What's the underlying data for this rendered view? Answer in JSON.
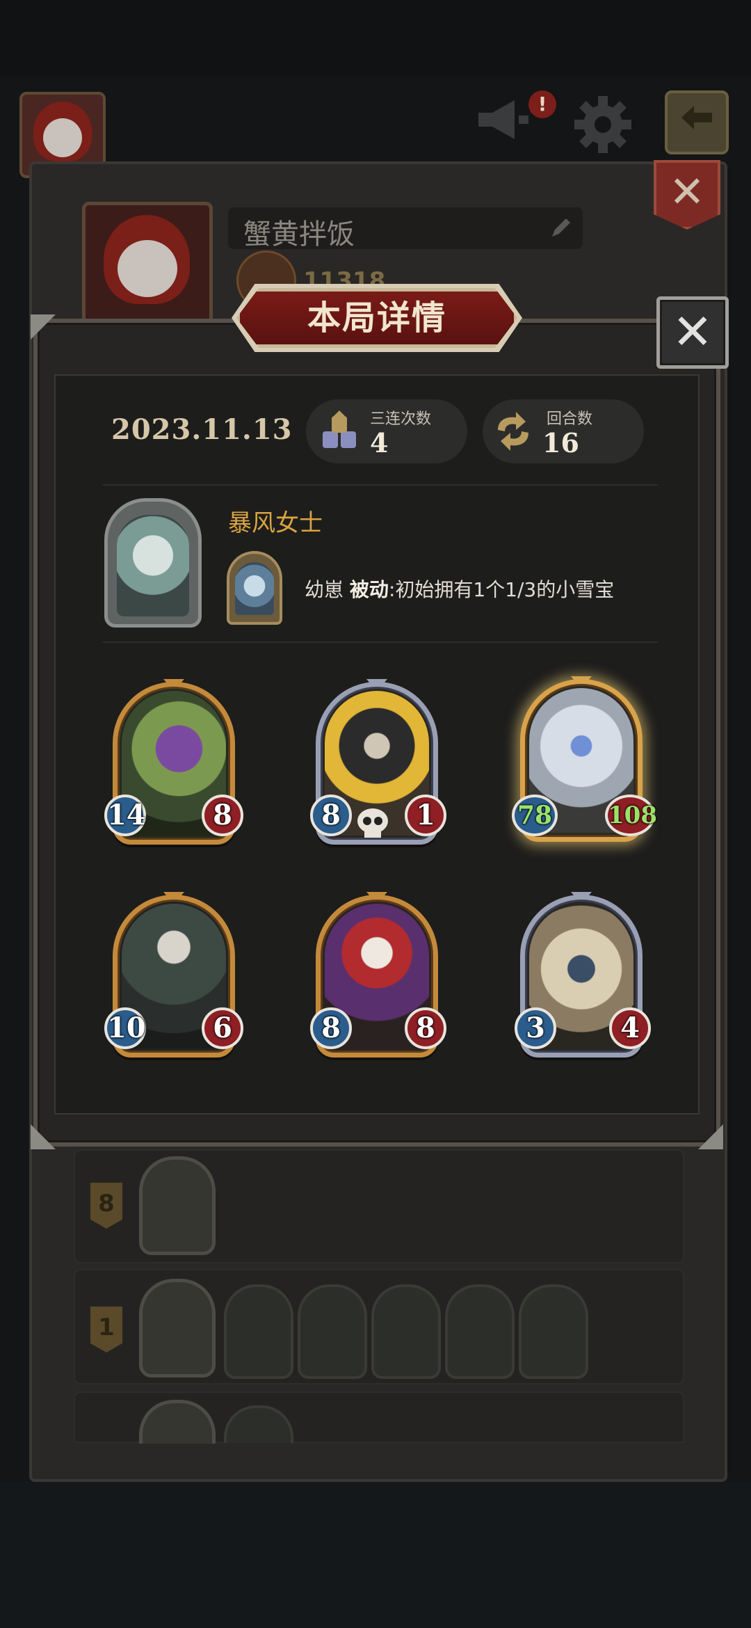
{
  "background": {
    "player_name": "蟹黄拌饭",
    "score": "11318",
    "notice_badge": "!",
    "rows": [
      {
        "rank": "8"
      },
      {
        "rank": "1"
      },
      {
        "rank": ""
      }
    ]
  },
  "dialog": {
    "title": "本局详情",
    "close_symbol": "✕",
    "date": "2023.11.13",
    "stats": [
      {
        "label": "三连次数",
        "value": "4",
        "icon": "triple-icon"
      },
      {
        "label": "回合数",
        "value": "16",
        "icon": "turns-icon"
      }
    ],
    "hero": {
      "name": "暴风女士",
      "skill_name": "幼崽",
      "skill_type": "被动",
      "skill_desc": ":初始拥有1个1/3的小雪宝"
    },
    "minions": [
      {
        "attack": "14",
        "health": "8",
        "frame": "gold",
        "art": "purple-dragon"
      },
      {
        "attack": "8",
        "health": "1",
        "frame": "silver",
        "art": "hooded-bandit"
      },
      {
        "attack": "78",
        "health": "108",
        "frame": "gold",
        "art": "yeti-kid",
        "golden": true
      },
      {
        "attack": "10",
        "health": "6",
        "frame": "gold",
        "art": "skull-sorcerer"
      },
      {
        "attack": "8",
        "health": "8",
        "frame": "gold",
        "art": "jester-clown"
      },
      {
        "attack": "3",
        "health": "4",
        "frame": "silver",
        "art": "beast-lord"
      }
    ]
  },
  "colors": {
    "accent_gold": "#d9a441",
    "banner_red": "#7a1b17",
    "attack_blue": "#2b5d8c",
    "health_red": "#8e1f24",
    "buffed_green": "#9ce26a"
  }
}
